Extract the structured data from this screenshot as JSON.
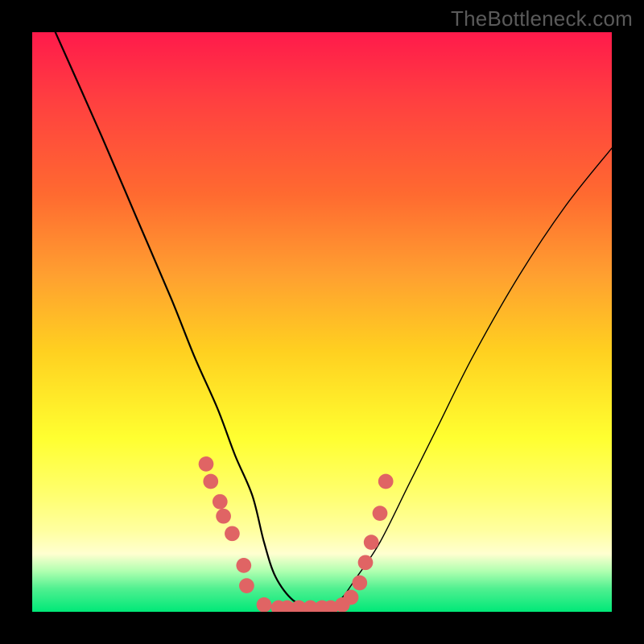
{
  "watermark": "TheBottleneck.com",
  "colors": {
    "background": "#000000",
    "dot": "#e06464",
    "curve": "#000000",
    "gradient_top": "#ff1a4b",
    "gradient_bottom": "#00e878"
  },
  "chart_data": {
    "type": "line",
    "title": "",
    "xlabel": "",
    "ylabel": "",
    "xlim": [
      0,
      100
    ],
    "ylim": [
      0,
      100
    ],
    "note": "Coordinates are in percent of the 720×720 plot area; y=0 is top, y=100 is bottom. The curve represents a bottleneck profile bottoming out near x≈40–50 and rising on both sides.",
    "series": [
      {
        "name": "bottleneck-curve",
        "x": [
          4,
          12,
          18,
          24,
          28,
          32,
          35,
          38,
          40,
          42,
          45,
          48,
          50,
          53,
          56,
          60,
          65,
          70,
          76,
          84,
          92,
          100
        ],
        "y": [
          0,
          18,
          32,
          46,
          56,
          65,
          73,
          80,
          88,
          94,
          98,
          99,
          99,
          98,
          94,
          88,
          78,
          68,
          56,
          42,
          30,
          20
        ]
      }
    ],
    "dots": {
      "note": "Salmon markers overlaid on the curve near the trough region.",
      "x": [
        30.0,
        30.8,
        32.4,
        33.0,
        34.5,
        36.5,
        37.0,
        40.0,
        42.5,
        44.0,
        46.0,
        48.0,
        50.0,
        51.5,
        53.5,
        55.0,
        56.5,
        57.5,
        58.5,
        60.0,
        61.0
      ],
      "y": [
        74.5,
        77.5,
        81.0,
        83.5,
        86.5,
        92.0,
        95.5,
        98.8,
        99.3,
        99.3,
        99.3,
        99.3,
        99.3,
        99.3,
        98.8,
        97.5,
        95.0,
        91.5,
        88.0,
        83.0,
        77.5
      ],
      "r": 1.3
    }
  }
}
